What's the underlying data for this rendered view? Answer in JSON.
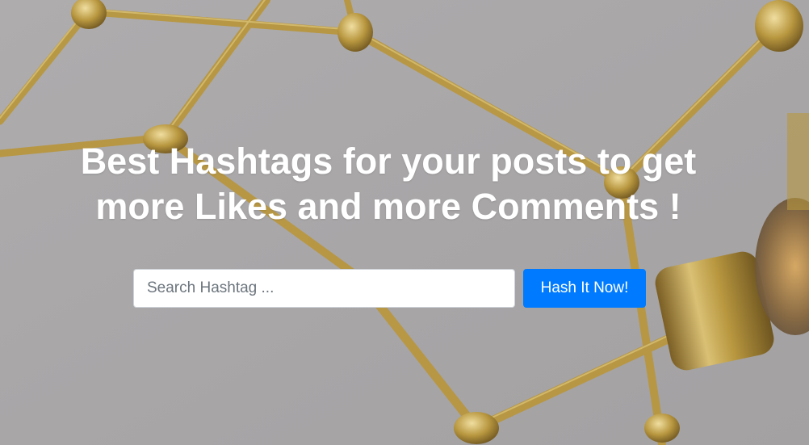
{
  "hero": {
    "headline_line1": "Best Hashtags for your posts to get",
    "headline_line2": "more Likes and more Comments !",
    "background_colors": {
      "base": "#a9a7a8",
      "brass": "#b8973f",
      "brass_highlight": "#e8d38a",
      "brass_shadow": "#6e5520"
    }
  },
  "search": {
    "placeholder": "Search Hashtag ...",
    "value": "",
    "button_label": "Hash It Now!",
    "button_color": "#007bff"
  }
}
